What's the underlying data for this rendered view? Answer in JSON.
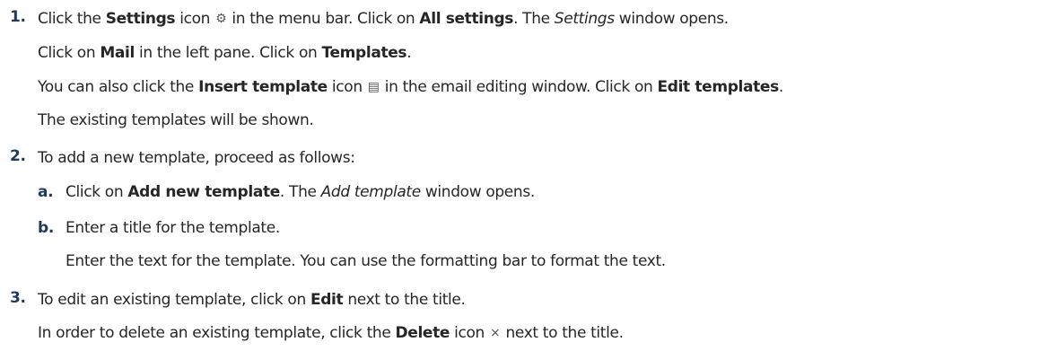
{
  "steps": [
    {
      "number": "1.",
      "lines": [
        {
          "a": "Click the ",
          "b": "Settings",
          "c": " icon ",
          "icon": "⚙",
          "d": " in the menu bar. Click on ",
          "e": "All settings",
          "f": ". The ",
          "g": "Settings",
          "h": " window opens."
        },
        {
          "a": "Click on ",
          "b": "Mail",
          "c": " in the left pane. Click on ",
          "d": "Templates",
          "e": "."
        },
        {
          "a": "You can also click the ",
          "b": "Insert template",
          "c": " icon ",
          "icon": "▤",
          "d": " in the email editing window. Click on ",
          "e": "Edit templates",
          "f": "."
        },
        {
          "a": "The existing templates will be shown."
        }
      ]
    },
    {
      "number": "2.",
      "line": "To add a new template, proceed as follows:",
      "substeps": [
        {
          "letter": "a.",
          "lines": [
            {
              "a": "Click on ",
              "b": "Add new template",
              "c": ". The ",
              "d": "Add template",
              "e": " window opens."
            }
          ]
        },
        {
          "letter": "b.",
          "lines": [
            {
              "a": "Enter a title for the template."
            },
            {
              "a": "Enter the text for the template. You can use the formatting bar to format the text."
            }
          ]
        }
      ]
    },
    {
      "number": "3.",
      "lines": [
        {
          "a": "To edit an existing template, click on ",
          "b": "Edit",
          "c": " next to the title."
        },
        {
          "a": "In order to delete an existing template, click the ",
          "b": "Delete",
          "c": " icon ",
          "icon": "×",
          "d": " next to the title."
        }
      ]
    }
  ],
  "icons": {
    "settings": "gear-icon",
    "insert_template": "template-icon",
    "delete": "close-icon"
  }
}
